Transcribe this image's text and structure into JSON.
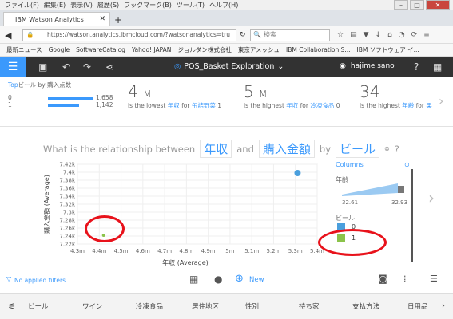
{
  "browser": {
    "menu": [
      "ファイル(F)",
      "編集(E)",
      "表示(V)",
      "履歴(S)",
      "ブックマーク(B)",
      "ツール(T)",
      "ヘルプ(H)"
    ],
    "tab_title": "IBM Watson Analytics",
    "url": "https://watson.analytics.ibmcloud.com/?watsonanalytics=tru",
    "search_placeholder": "検索",
    "bookmarks": [
      "最新ニュース",
      "Google",
      "SoftwareCatalog",
      "Yahoo! JAPAN",
      "ジョルダン株式会社",
      "東京アメッシュ",
      "IBM Collaboration S...",
      "IBM ソフトウェア イ..."
    ]
  },
  "app": {
    "title": "POS_Basket Exploration",
    "user": "hajime sano"
  },
  "kpi": {
    "first": {
      "title_prefix": "Top",
      "title_field": "ビール",
      "title_by": "by",
      "title_measure": "購入点数",
      "rows": [
        {
          "cat": "0",
          "value": "1,658",
          "fill": 1.0
        },
        {
          "cat": "1",
          "value": "1,142",
          "fill": 0.69
        }
      ]
    },
    "second": {
      "num": "4",
      "unit": "M",
      "desc1": "is the lowest",
      "field": "年収",
      "desc2": "for",
      "item": "缶詰野菜",
      "count": "1"
    },
    "third": {
      "num": "5",
      "unit": "M",
      "desc1": "is the highest",
      "field": "年収",
      "desc2": "for",
      "item": "冷凍食品",
      "count": "0"
    },
    "fourth": {
      "num": "34",
      "desc1": "is the highest",
      "field": "年齢",
      "desc2": "for",
      "item": "果"
    }
  },
  "question": {
    "prefix": "What is the relationship between",
    "term1": "年収",
    "and": "and",
    "term2": "購入金額",
    "by": "by",
    "term3": "ビール",
    "help": "?"
  },
  "chart_data": {
    "type": "scatter",
    "xlabel": "年収 (Average)",
    "ylabel": "購入金額 (Average)",
    "x_ticks": [
      "4.3m",
      "4.4m",
      "4.5m",
      "4.6m",
      "4.7m",
      "4.8m",
      "4.9m",
      "5m",
      "5.1m",
      "5.2m",
      "5.3m",
      "5.4m"
    ],
    "y_ticks": [
      "7.42k",
      "7.4k",
      "7.38k",
      "7.36k",
      "7.34k",
      "7.32k",
      "7.3k",
      "7.28k",
      "7.26k",
      "7.24k",
      "7.22k"
    ],
    "xlim": [
      4.3,
      5.4
    ],
    "ylim": [
      7.22,
      7.42
    ],
    "series": [
      {
        "name": "0",
        "x": 5.31,
        "y": 7.398,
        "color": "#4a9fdd"
      },
      {
        "name": "1",
        "x": 4.42,
        "y": 7.242,
        "color": "#8bc34a"
      }
    ]
  },
  "legend": {
    "columns_label": "Columns",
    "age_label": "年齢",
    "age_min": "32.61",
    "age_max": "32.93",
    "beer_label": "ビール",
    "items": [
      {
        "label": "0",
        "color": "#4a9fdd"
      },
      {
        "label": "1",
        "color": "#8bc34a"
      }
    ]
  },
  "bottom": {
    "filters_text": "No applied filters",
    "new_label": "New"
  },
  "fields": [
    "ビール",
    "ワイン",
    "冷凍食品",
    "居住地区",
    "性別",
    "持ち家",
    "支払方法",
    "日用品"
  ]
}
